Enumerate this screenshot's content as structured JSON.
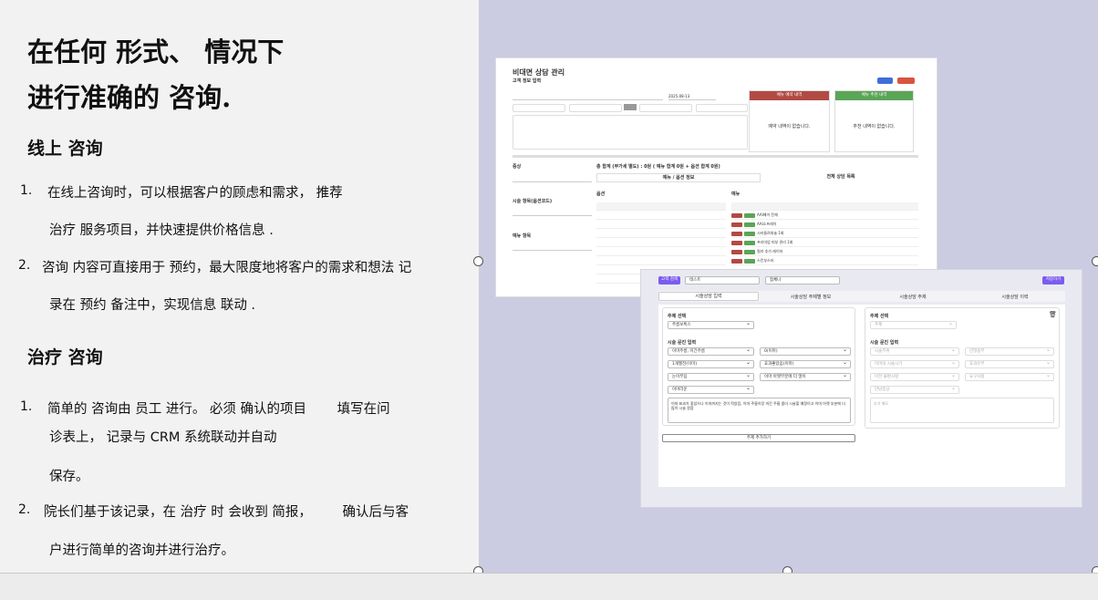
{
  "left": {
    "title_line1": "在任何 形式、 情况下",
    "title_line2": "进行准确的 咨询.",
    "section1": "线上 咨询",
    "s1_items": [
      {
        "num": "1.",
        "line1": "在线上咨询时，可以根据客户的顾虑和需求， 推荐",
        "line2": "治疗 服务项目，并快速提供价格信息 ."
      },
      {
        "num": "2.",
        "line1": "咨询 内容可直接用于 预约，最大限度地将客户的需求和想法 记",
        "line2": "录在 预约 备注中，实现信息 联动 ."
      }
    ],
    "section2": "治疗 咨询",
    "s2_items": [
      {
        "num": "1.",
        "line1": "简单的 咨询由 员工 进行。 必须 确认的项目 　　填写在问",
        "line2": "诊表上， 记录与 CRM 系统联动并自动",
        "line3": "保存。"
      },
      {
        "num": "2.",
        "line1": "院长们基于该记录，在 治疗 时 会收到 简报， 　　确认后与客",
        "line2": "户进行简单的咨询并进行治疗。"
      }
    ]
  },
  "shot1": {
    "title": "비대면 상담 관리",
    "subtitle": "고객 정보 입력",
    "date": "2025-08-13",
    "reserve_header": "예뉴 예약 내역",
    "reserve_empty": "예약 내역이 없습니다.",
    "recommend_header": "예뉴 추천 내역",
    "recommend_empty": "추천 내역이 없습니다.",
    "summary": "총 합계 (부가세 별도) : 0원 ( 예뉴 합계 0원 + 옵션 합계 0원)",
    "tab_menu": "예뉴 / 옵션 정보",
    "tab_all": "전체 상담 목록",
    "col_left": "옵션",
    "col_right": "예뉴",
    "side": [
      "증상",
      "시술 항목(옵션코드)",
      "예뉴 항목"
    ],
    "rows_right": [
      "AAI페이 전체",
      "AAI소프레이",
      "시러들려외술 1회",
      "프리미엄 피부 관리 1회",
      "필러 추가 레이저",
      "스킨부스터"
    ]
  },
  "shot2": {
    "customer_btn": "고객 검색",
    "customer_value": "테스트",
    "manager_value": "접체나",
    "save_btn": "저장하기",
    "tabs": [
      "시술상담 입력",
      "시술상담 주제별 정보",
      "시술상담 주제",
      "시술상담 이력"
    ],
    "subject_label": "주제 선택",
    "subject_value": "주름보톡스",
    "question_label": "시술 문진 입력",
    "q_left": [
      "이마주름, 미간주름",
      "1개월전(이마)",
      "눈이부음",
      "이마라운"
    ],
    "q_right": [
      "0(이마)",
      "효과좋았음(이마)",
      "이마 아랫부분에 더 많이"
    ],
    "memo": "이마 표과가 좋았으나 이마까지는 것이 적었음, 이마 주름이랑 미간 주름 좀더 시술할 예정이고 이마 아랫 부분에 더 많이 시술 원함",
    "add_btn": "주제 추가하기",
    "r_subject_label": "주제 선택",
    "r_subject_value": "주제",
    "r_question_label": "시술 문진 입력",
    "r_q_left": [
      "시술부위",
      "이마의 시술시기",
      "이전 불편사항",
      "만남증상"
    ],
    "r_q_right": [
      "만많용부",
      "효과유무",
      "요구사항"
    ],
    "r_memo": "추가 메모"
  },
  "colors": {
    "accent_blue": "#3e6fd8",
    "accent_red": "#d9543f",
    "card_green": "#5aa556",
    "card_red": "#b24a44",
    "purple_btn": "#7a5cf0"
  }
}
